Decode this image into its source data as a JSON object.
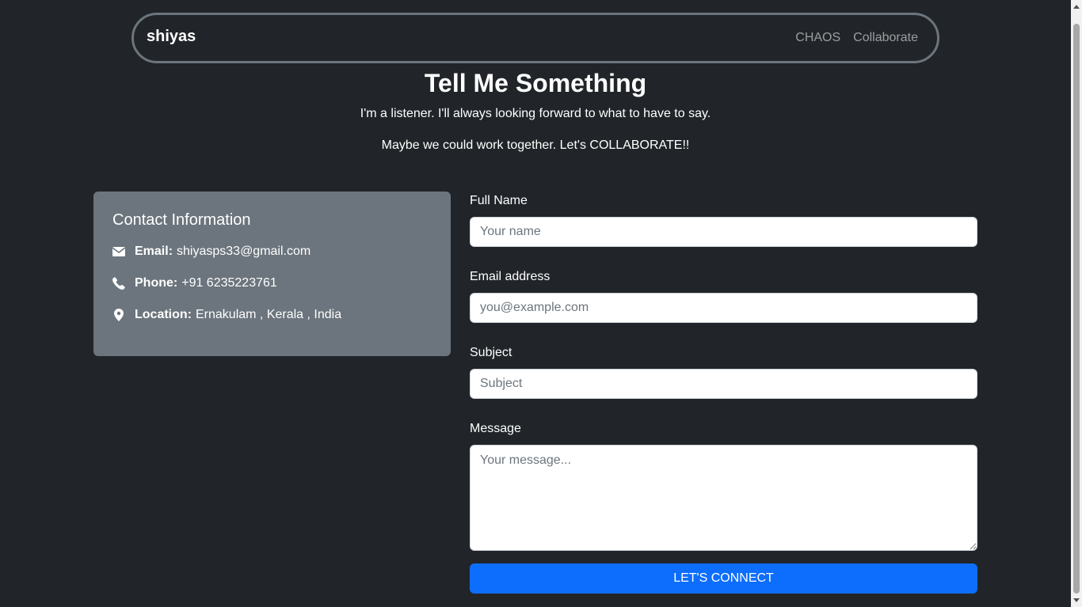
{
  "nav": {
    "brand": "shiyas",
    "links": [
      "CHAOS",
      "Collaborate"
    ]
  },
  "hero": {
    "title": "Tell Me Something",
    "line1": "I'm a listener. I'll always looking forward to what to have to say.",
    "line2": "Maybe we could work together. Let's COLLABORATE!!"
  },
  "contact": {
    "heading": "Contact Information",
    "email_label": "Email:",
    "email_value": "shiyasps33@gmail.com",
    "phone_label": "Phone:",
    "phone_value": "+91 6235223761",
    "location_label": "Location:",
    "location_value": "Ernakulam , Kerala , India",
    "icons": [
      "envelope-icon",
      "phone-icon",
      "location-pin-icon"
    ]
  },
  "form": {
    "name_label": "Full Name",
    "name_placeholder": "Your name",
    "email_label": "Email address",
    "email_placeholder": "you@example.com",
    "subject_label": "Subject",
    "subject_placeholder": "Subject",
    "message_label": "Message",
    "message_placeholder": "Your message...",
    "submit_label": "LET'S CONNECT"
  },
  "colors": {
    "background": "#212529",
    "card": "#6c757d",
    "accent": "#0d6efd"
  }
}
